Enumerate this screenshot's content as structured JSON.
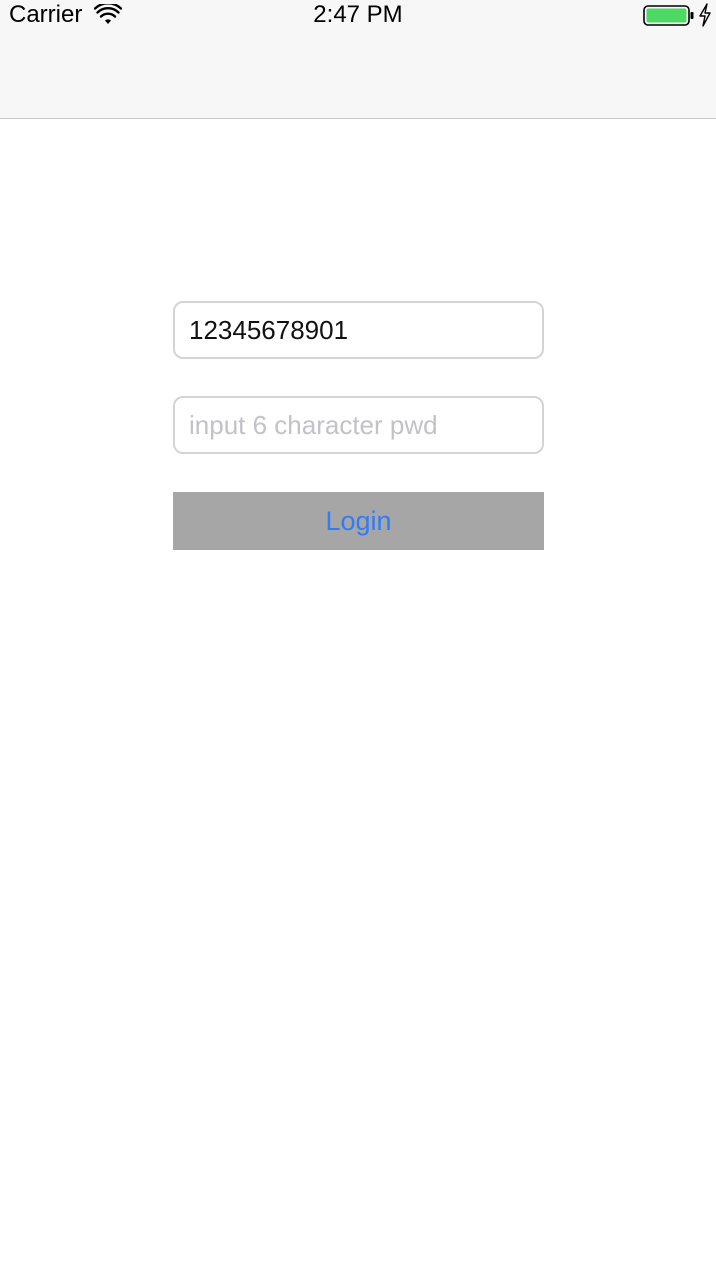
{
  "status_bar": {
    "carrier": "Carrier",
    "time": "2:47 PM",
    "wifi_icon": "wifi-icon",
    "battery_icon": "battery-icon",
    "charging_icon": "charging-bolt-icon",
    "battery_color": "#4cd964"
  },
  "login_form": {
    "phone_value": "12345678901",
    "password_placeholder": "input 6 character pwd",
    "login_label": "Login"
  },
  "colors": {
    "button_background": "#a6a6a6",
    "button_text": "#2f7cf6",
    "field_border": "#d4d4d4",
    "placeholder": "#c2c2c7"
  }
}
